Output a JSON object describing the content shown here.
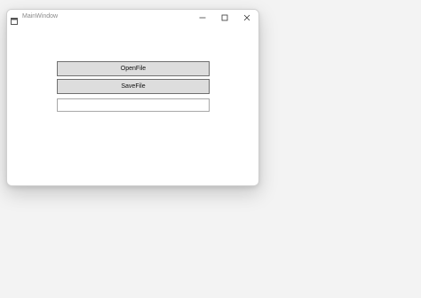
{
  "window": {
    "title": "MainWindow",
    "controls": {
      "minimize_icon": "minimize-icon",
      "maximize_icon": "maximize-icon",
      "close_icon": "close-icon"
    }
  },
  "content": {
    "open_button_label": "OpenFile",
    "save_button_label": "SaveFile",
    "textbox_value": ""
  },
  "colors": {
    "desktop_background": "#f3f3f3",
    "window_background": "#ffffff",
    "button_background": "#dddddd",
    "button_border": "#707070",
    "title_text": "#8a8a8a"
  }
}
